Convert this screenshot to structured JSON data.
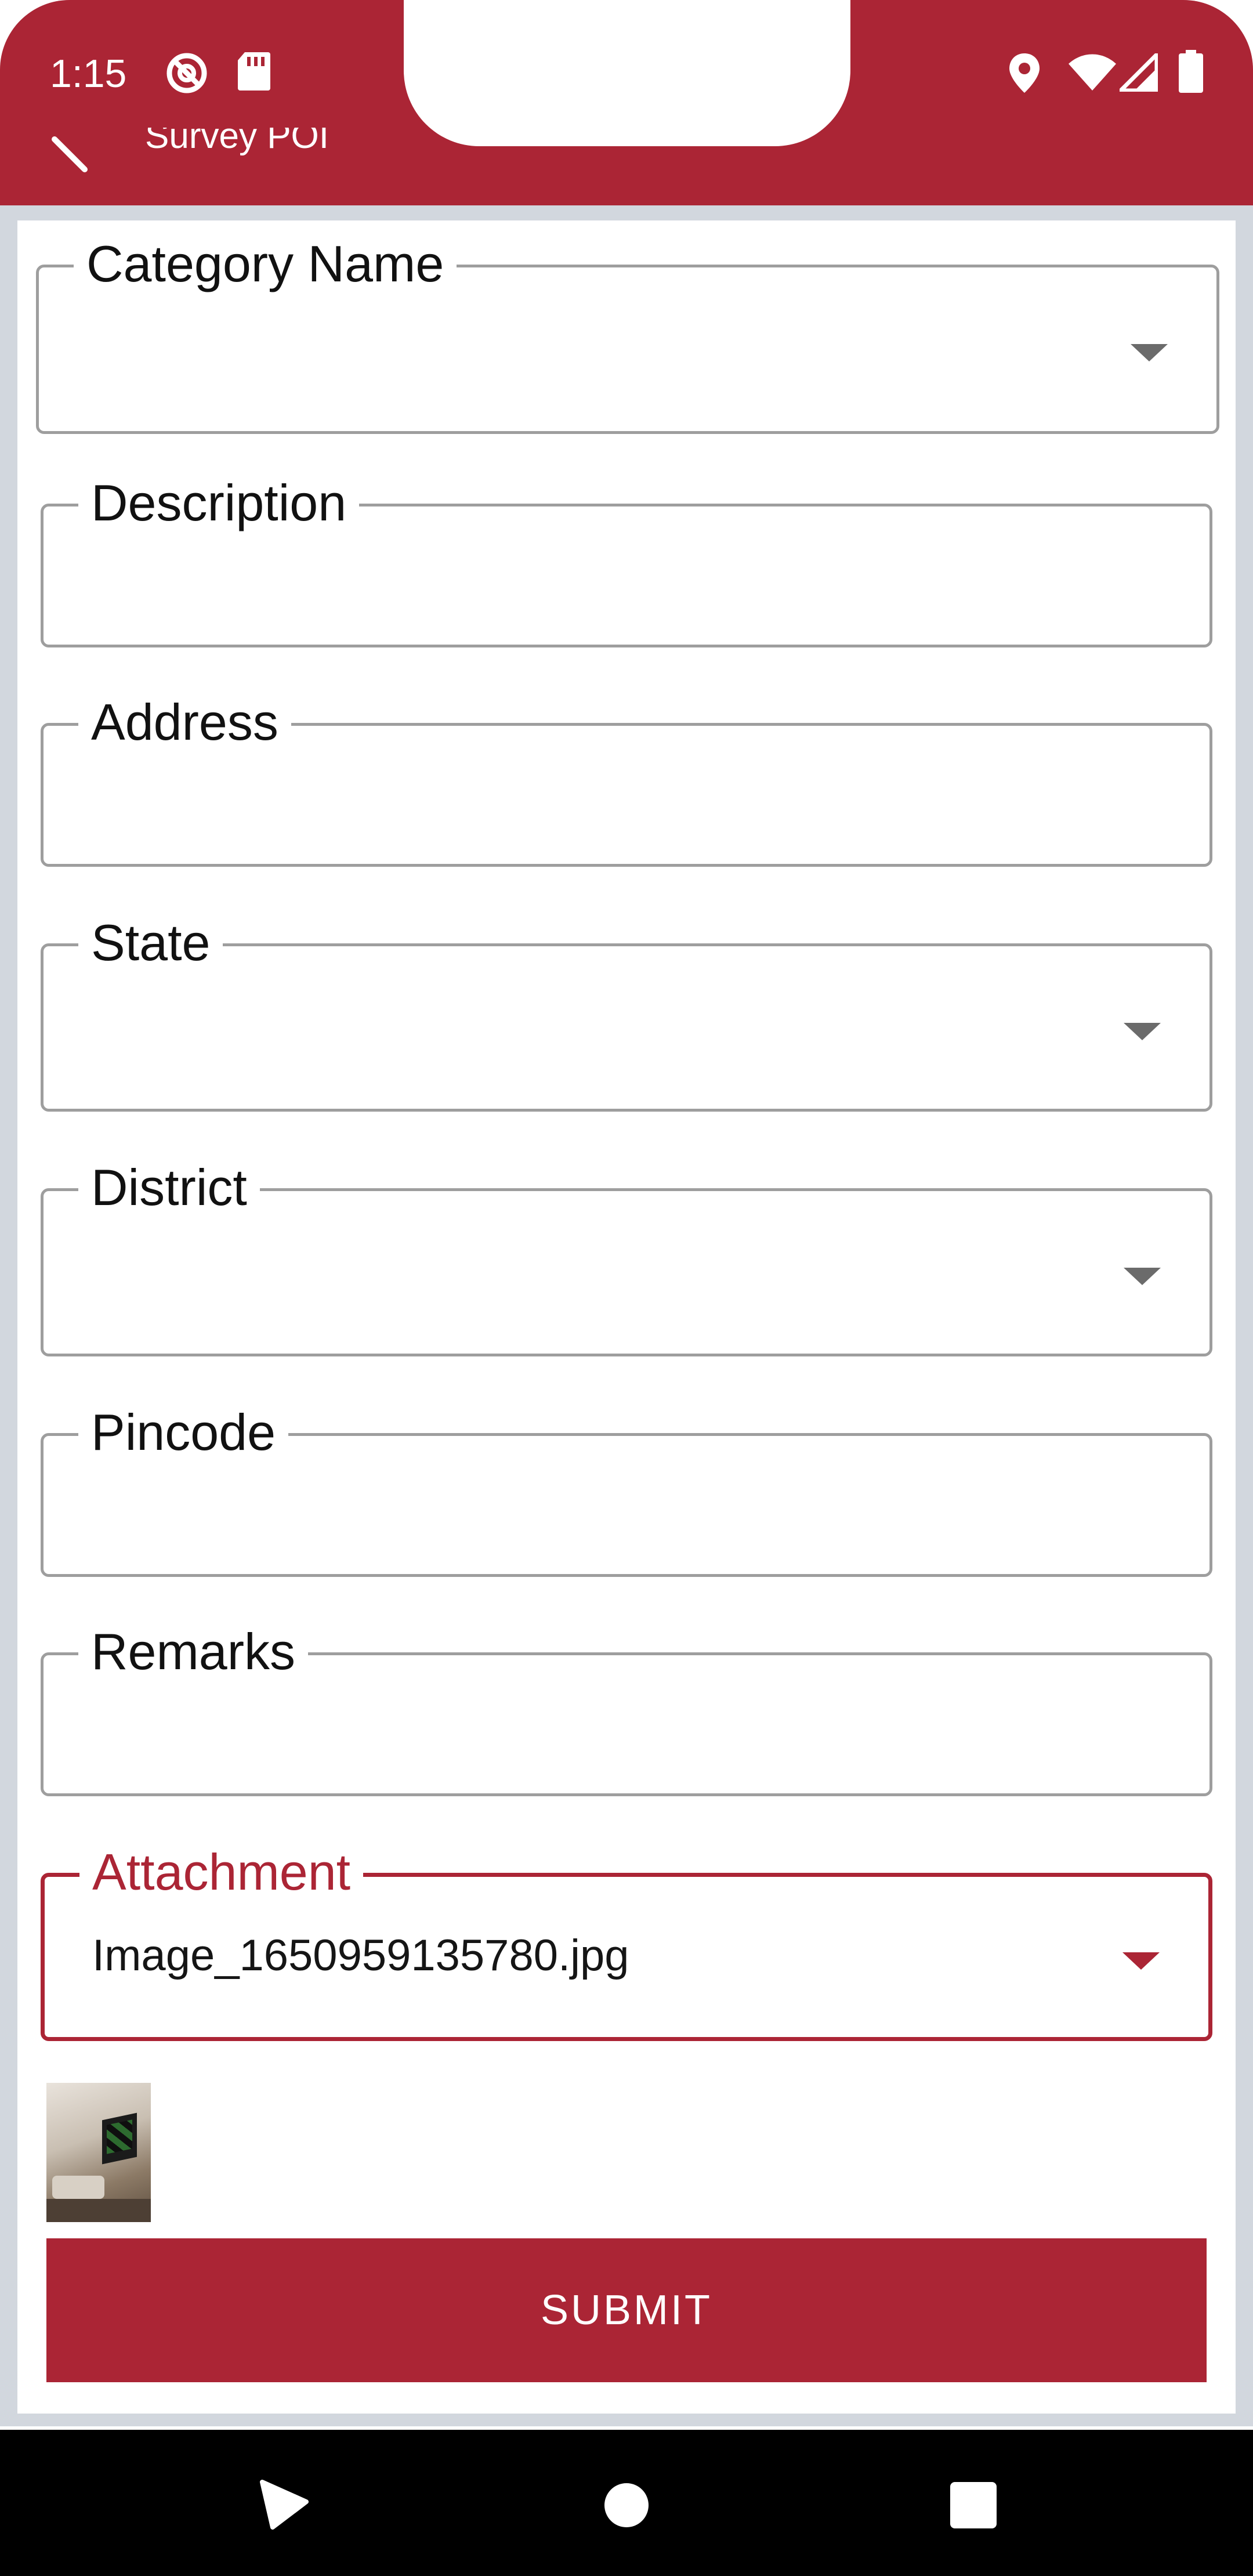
{
  "status_bar": {
    "time": "1:15",
    "left_icons": [
      "do-not-disturb-icon",
      "sd-card-icon"
    ],
    "right_icons": [
      "location-icon",
      "wifi-icon",
      "cellular-signal-icon",
      "battery-icon"
    ]
  },
  "app_bar": {
    "title": "Survey POI",
    "back_icon": "back-arrow-icon",
    "color": "#ab2535"
  },
  "form": {
    "fields": [
      {
        "label": "Category Name",
        "type": "dropdown",
        "value": ""
      },
      {
        "label": "Description",
        "type": "text",
        "value": ""
      },
      {
        "label": "Address",
        "type": "text",
        "value": ""
      },
      {
        "label": "State",
        "type": "dropdown",
        "value": ""
      },
      {
        "label": "District",
        "type": "dropdown",
        "value": ""
      },
      {
        "label": "Pincode",
        "type": "text",
        "value": ""
      },
      {
        "label": "Remarks",
        "type": "text",
        "value": ""
      },
      {
        "label": "Attachment",
        "type": "dropdown",
        "value": "Image_1650959135780.jpg",
        "focused": true
      }
    ],
    "thumbnail": "attachment-thumbnail",
    "submit_label": "SUBMIT"
  },
  "nav_bar": {
    "buttons": [
      "back-triangle-icon",
      "home-circle-icon",
      "recents-square-icon"
    ]
  }
}
